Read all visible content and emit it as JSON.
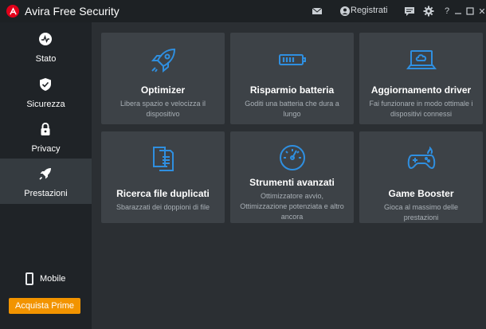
{
  "app": {
    "title": "Avira Free Security"
  },
  "titlebar": {
    "registered_label": "Registrati",
    "help_glyph": "?",
    "close_glyph": "✕"
  },
  "sidebar": {
    "items": [
      {
        "label": "Stato",
        "icon": "status-icon"
      },
      {
        "label": "Sicurezza",
        "icon": "shield-icon"
      },
      {
        "label": "Privacy",
        "icon": "lock-icon"
      },
      {
        "label": "Prestazioni",
        "icon": "rocket-icon",
        "active": true
      }
    ],
    "mobile_label": "Mobile",
    "buy_label": "Acquista Prime"
  },
  "cards": [
    {
      "title": "Optimizer",
      "description": "Libera spazio e velocizza il dispositivo",
      "icon": "rocket-icon"
    },
    {
      "title": "Risparmio batteria",
      "description": "Goditi una batteria che dura a lungo",
      "icon": "battery-icon"
    },
    {
      "title": "Aggiornamento driver",
      "description": "Fai funzionare in modo ottimale i dispositivi connessi",
      "icon": "laptop-cloud-icon"
    },
    {
      "title": "Ricerca file duplicati",
      "description": "Sbarazzati dei doppioni di file",
      "icon": "duplicate-files-icon"
    },
    {
      "title": "Strumenti avanzati",
      "description": "Ottimizzatore avvio, Ottimizzazione potenziata e altro ancora",
      "icon": "speedometer-icon"
    },
    {
      "title": "Game Booster",
      "description": "Gioca al massimo delle prestazioni",
      "icon": "gamepad-icon"
    }
  ],
  "colors": {
    "accent_blue": "#2f8fe0",
    "buy_orange": "#f29400",
    "brand_red": "#e2001a"
  }
}
